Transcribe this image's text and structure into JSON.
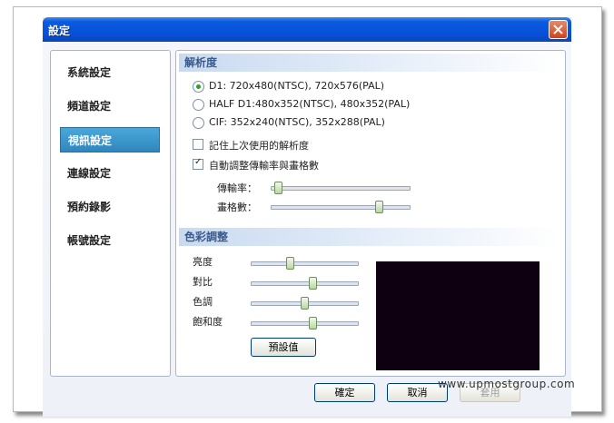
{
  "window": {
    "title": "設定"
  },
  "sidebar": {
    "items": [
      {
        "label": "系統設定"
      },
      {
        "label": "頻道設定"
      },
      {
        "label": "視訊設定"
      },
      {
        "label": "連線設定"
      },
      {
        "label": "預約錄影"
      },
      {
        "label": "帳號設定"
      }
    ],
    "active_index": 2
  },
  "resolution": {
    "header": "解析度",
    "options": [
      {
        "label": "D1: 720x480(NTSC), 720x576(PAL)",
        "selected": true
      },
      {
        "label": "HALF D1:480x352(NTSC), 480x352(PAL)",
        "selected": false
      },
      {
        "label": "CIF: 352x240(NTSC), 352x288(PAL)",
        "selected": false
      }
    ],
    "remember_label": "記住上次使用的解析度",
    "remember_checked": false,
    "auto_label": "自動調整傳輸率與畫格數",
    "auto_checked": true,
    "bitrate_label": "傳輸率：",
    "bitrate_level": 0.02,
    "framerate_label": "畫格數：",
    "framerate_level": 0.8
  },
  "color": {
    "header": "色彩調整",
    "brightness_label": "亮度",
    "brightness_level": 0.35,
    "contrast_label": "對比",
    "contrast_level": 0.58,
    "hue_label": "色調",
    "hue_level": 0.5,
    "saturation_label": "飽和度",
    "saturation_level": 0.58,
    "default_button": "預設值",
    "preview_color": "#0f0011"
  },
  "footer": {
    "ok_label": "確定",
    "cancel_label": "取消",
    "apply_label": "套用"
  },
  "watermark": "www.upmostgroup.com",
  "colors": {
    "titlebar": "#0650d6",
    "accent": "#2f86bf",
    "section_text": "#3a5a8c"
  }
}
